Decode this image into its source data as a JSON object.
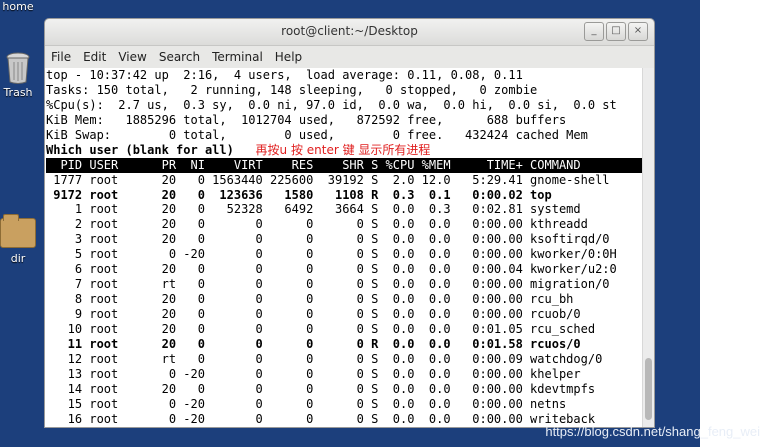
{
  "desktop": {
    "icons": [
      {
        "label": "home"
      },
      {
        "label": "Trash"
      },
      {
        "label": "dir"
      }
    ],
    "watermark": "https://blog.csdn.net/shang_feng_wei",
    "background_color": "#1c3f7c"
  },
  "window": {
    "title": "root@client:~/Desktop",
    "controls": [
      "_",
      "□",
      "×"
    ],
    "menu": [
      "File",
      "Edit",
      "View",
      "Search",
      "Terminal",
      "Help"
    ]
  },
  "terminal": {
    "summary": [
      "top - 10:37:42 up  2:16,  4 users,  load average: 0.11, 0.08, 0.11",
      "Tasks: 150 total,   2 running, 148 sleeping,   0 stopped,   0 zombie",
      "%Cpu(s):  2.7 us,  0.3 sy,  0.0 ni, 97.0 id,  0.0 wa,  0.0 hi,  0.0 si,  0.0 st",
      "KiB Mem:   1885296 total,  1012704 used,   872592 free,      688 buffers",
      "KiB Swap:        0 total,        0 used,        0 free.   432424 cached Mem"
    ],
    "prompt": "Which user (blank for all) ",
    "annotation": "再按u 按 enter 键 显示所有进程",
    "header": "  PID USER      PR  NI    VIRT    RES    SHR S %CPU %MEM     TIME+ COMMAND",
    "rows": [
      {
        "text": " 1777 root      20   0 1563440 225600  39192 S  2.0 12.0   5:29.41 gnome-shell",
        "bold": false
      },
      {
        "text": " 9172 root      20   0  123636   1580   1108 R  0.3  0.1   0:00.02 top",
        "bold": true
      },
      {
        "text": "    1 root      20   0   52328   6492   3664 S  0.0  0.3   0:02.81 systemd",
        "bold": false
      },
      {
        "text": "    2 root      20   0       0      0      0 S  0.0  0.0   0:00.00 kthreadd",
        "bold": false
      },
      {
        "text": "    3 root      20   0       0      0      0 S  0.0  0.0   0:00.00 ksoftirqd/0",
        "bold": false
      },
      {
        "text": "    5 root       0 -20       0      0      0 S  0.0  0.0   0:00.00 kworker/0:0H",
        "bold": false
      },
      {
        "text": "    6 root      20   0       0      0      0 S  0.0  0.0   0:00.04 kworker/u2:0",
        "bold": false
      },
      {
        "text": "    7 root      rt   0       0      0      0 S  0.0  0.0   0:00.00 migration/0",
        "bold": false
      },
      {
        "text": "    8 root      20   0       0      0      0 S  0.0  0.0   0:00.00 rcu_bh",
        "bold": false
      },
      {
        "text": "    9 root      20   0       0      0      0 S  0.0  0.0   0:00.00 rcuob/0",
        "bold": false
      },
      {
        "text": "   10 root      20   0       0      0      0 S  0.0  0.0   0:01.05 rcu_sched",
        "bold": false
      },
      {
        "text": "   11 root      20   0       0      0      0 R  0.0  0.0   0:01.58 rcuos/0",
        "bold": true
      },
      {
        "text": "   12 root      rt   0       0      0      0 S  0.0  0.0   0:00.09 watchdog/0",
        "bold": false
      },
      {
        "text": "   13 root       0 -20       0      0      0 S  0.0  0.0   0:00.00 khelper",
        "bold": false
      },
      {
        "text": "   14 root      20   0       0      0      0 S  0.0  0.0   0:00.00 kdevtmpfs",
        "bold": false
      },
      {
        "text": "   15 root       0 -20       0      0      0 S  0.0  0.0   0:00.00 netns",
        "bold": false
      },
      {
        "text": "   16 root       0 -20       0      0      0 S  0.0  0.0   0:00.00 writeback",
        "bold": false
      }
    ]
  }
}
